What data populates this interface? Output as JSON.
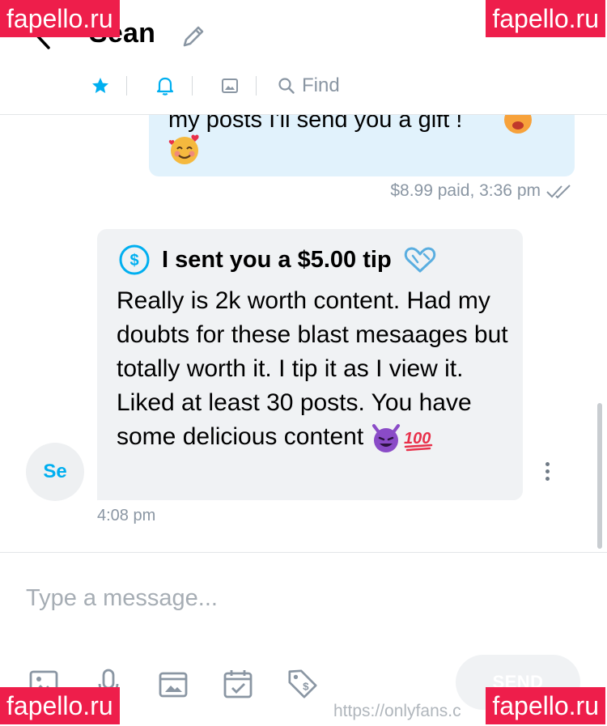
{
  "header": {
    "contact_name": "Sean",
    "find_label": "Find"
  },
  "messages": {
    "sent": {
      "text": "my posts I'll send you a gift !",
      "meta": "$8.99 paid, 3:36 pm"
    },
    "received": {
      "avatar_initials": "Se",
      "tip_text": "I sent you a $5.00 tip",
      "body": "Really is 2k worth content. Had my doubts for these blast mesaages but totally worth it. I tip it as I view it. Liked at least 30 posts. You have some delicious content",
      "time": "4:08 pm"
    }
  },
  "composer": {
    "placeholder": "Type a message...",
    "send_label": "SEND",
    "url_text": "https://onlyfans.c"
  },
  "watermarks": {
    "top_left": "fapello.ru",
    "top_right": "fapello.ru",
    "bottom_left": "fapello.ru",
    "bottom_right": "fapello.ru"
  },
  "icons": {
    "back": "chevron-left-icon",
    "edit": "pencil-icon",
    "star": "star-icon",
    "bell": "bell-icon",
    "gallery": "image-icon",
    "search": "search-icon",
    "tip": "dollar-circle-icon",
    "heart": "heart-icon",
    "devil": "smiling-devil-emoji",
    "hundred": "hundred-points-emoji",
    "smiling_hearts": "smiling-face-with-hearts-emoji",
    "check": "double-check-icon",
    "more": "more-vertical-icon"
  },
  "colors": {
    "accent": "#00aff0",
    "sent_bubble": "#e1f2fc",
    "received_bubble": "#f0f2f4",
    "muted_text": "#8a96a3",
    "watermark": "#ee1e4b"
  }
}
